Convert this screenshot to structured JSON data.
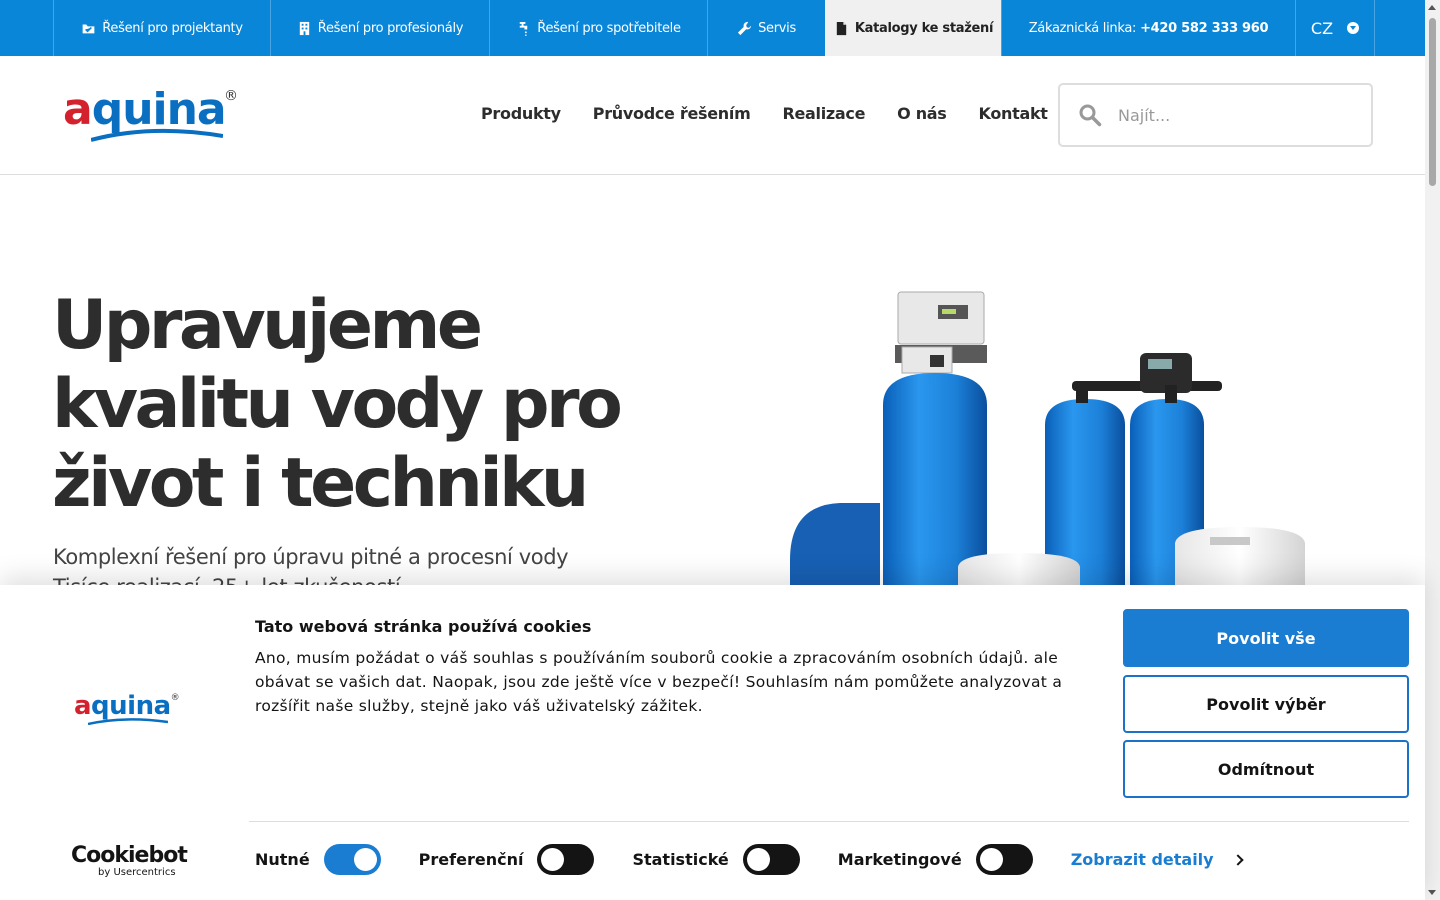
{
  "topbar": {
    "items": [
      {
        "label": "Řešení pro projektanty",
        "icon": "folder-check-icon"
      },
      {
        "label": "Řešení pro profesionály",
        "icon": "building-icon"
      },
      {
        "label": "Řešení pro spotřebitele",
        "icon": "faucet-icon"
      },
      {
        "label": "Servis",
        "icon": "wrench-icon"
      },
      {
        "label": "Katalogy ke stažení",
        "icon": "document-icon",
        "active": true
      }
    ],
    "phone_label": "Zákaznická linka:",
    "phone_number": "+420 582 333 960",
    "language": "CZ"
  },
  "header": {
    "logo_text_a": "a",
    "logo_text_rest": "quina",
    "logo_reg": "®",
    "nav": [
      "Produkty",
      "Průvodce řešením",
      "Realizace",
      "O nás",
      "Kontakt"
    ],
    "search_placeholder": "Najít..."
  },
  "hero": {
    "title_line1": "Upravujeme",
    "title_line2": "kvalitu vody pro",
    "title_line3": "život i techniku",
    "subtitle": "Komplexní řešení pro úpravu pitné a procesní vody",
    "subtitle2": "Tisíce realizací, 25+ let zkušeností"
  },
  "cookie": {
    "logo_text": "aquina",
    "title": "Tato webová stránka používá cookies",
    "text": "Ano, musím požádat o váš souhlas s používáním souborů cookie a zpracováním osobních údajů. ale obávat se vašich dat. Naopak, jsou zde ještě více v bezpečí! Souhlasím nám pomůžete analyzovat a rozšířit naše služby, stejně jako váš uživatelský zážitek.",
    "btn_allow_all": "Povolit vše",
    "btn_allow_selection": "Povolit výběr",
    "btn_reject": "Odmítnout",
    "toggles": [
      {
        "label": "Nutné",
        "on": true
      },
      {
        "label": "Preferenční",
        "on": false
      },
      {
        "label": "Statistické",
        "on": false
      },
      {
        "label": "Marketingové",
        "on": false
      }
    ],
    "details_link": "Zobrazit detaily",
    "cookiebot_brand": "Cookiebot",
    "cookiebot_by": "by Usercentrics"
  },
  "colors": {
    "brand_blue": "#0a86d8",
    "brand_red": "#d3212d",
    "button_blue": "#1a7dd1"
  }
}
